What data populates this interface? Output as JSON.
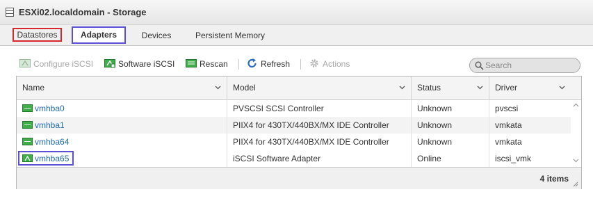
{
  "window": {
    "title": "ESXi02.localdomain - Storage",
    "icon": "storage-icon"
  },
  "tabs": [
    {
      "label": "Datastores",
      "highlight": "#d6262e"
    },
    {
      "label": "Adapters",
      "selected": true,
      "highlight": "#5b4fd6"
    },
    {
      "label": "Devices"
    },
    {
      "label": "Persistent Memory"
    }
  ],
  "toolbar": {
    "configure_iscsi": {
      "label": "Configure iSCSI",
      "icon": "configure-iscsi-icon",
      "enabled": false
    },
    "software_iscsi": {
      "label": "Software iSCSI",
      "icon": "software-iscsi-icon"
    },
    "rescan": {
      "label": "Rescan",
      "icon": "rescan-icon"
    },
    "refresh": {
      "label": "Refresh",
      "icon": "refresh-icon"
    },
    "actions": {
      "label": "Actions",
      "icon": "gear-icon",
      "enabled": false
    }
  },
  "search": {
    "placeholder": "Search",
    "value": ""
  },
  "table": {
    "columns": [
      "Name",
      "Model",
      "Status",
      "Driver"
    ],
    "rows": [
      {
        "name": "vmhba0",
        "model": "PVSCSI SCSI Controller",
        "status": "Unknown",
        "driver": "pvscsi"
      },
      {
        "name": "vmhba1",
        "model": "PIIX4 for 430TX/440BX/MX IDE Controller",
        "status": "Unknown",
        "driver": "vmkata"
      },
      {
        "name": "vmhba64",
        "model": "PIIX4 for 430TX/440BX/MX IDE Controller",
        "status": "Unknown",
        "driver": "vmkata"
      },
      {
        "name": "vmhba65",
        "model": "iSCSI Software Adapter",
        "status": "Online",
        "driver": "iscsi_vmk",
        "highlighted": true
      }
    ],
    "footer_count": "4 items"
  },
  "colors": {
    "link": "#1f6bb1",
    "hba_icon": "#2e9e3a",
    "refresh_icon": "#2a6cc0",
    "highlight_red": "#d6262e",
    "highlight_blue": "#5b4fd6"
  }
}
